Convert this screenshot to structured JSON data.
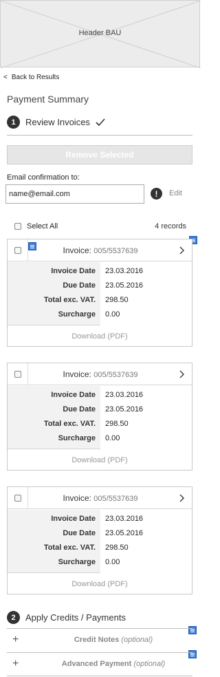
{
  "header": {
    "label": "Header BAU"
  },
  "nav": {
    "back_label": "Back to Results",
    "back_glyph": "<"
  },
  "page_title": "Payment Summary",
  "steps": [
    {
      "number": "1",
      "label": "Review Invoices",
      "done": true
    },
    {
      "number": "2",
      "label": "Apply Credits / Payments"
    }
  ],
  "actions": {
    "remove_selected": "Remove Selected"
  },
  "email": {
    "label": "Email confirmation to:",
    "value": "name@email.com",
    "alert_glyph": "!",
    "edit_label": "Edit"
  },
  "selection": {
    "select_all": "Select All",
    "records": "4 records"
  },
  "invoices": [
    {
      "title_label": "Invoice:",
      "number": "005/5537639",
      "invoice_date_label": "Invoice Date",
      "invoice_date": "23.03.2016",
      "due_date_label": "Due Date",
      "due_date": "23.05.2016",
      "total_label": "Total exc. VAT.",
      "total": "298.50",
      "surcharge_label": "Surcharge",
      "surcharge": "0.00",
      "download": "Download (PDF)"
    },
    {
      "title_label": "Invoice:",
      "number": "005/5537639",
      "invoice_date_label": "Invoice Date",
      "invoice_date": "23.03.2016",
      "due_date_label": "Due Date",
      "due_date": "23.05.2016",
      "total_label": "Total exc. VAT.",
      "total": "298.50",
      "surcharge_label": "Surcharge",
      "surcharge": "0.00",
      "download": "Download (PDF)"
    },
    {
      "title_label": "Invoice:",
      "number": "005/5537639",
      "invoice_date_label": "Invoice Date",
      "invoice_date": "23.03.2016",
      "due_date_label": "Due Date",
      "due_date": "23.05.2016",
      "total_label": "Total exc. VAT.",
      "total": "298.50",
      "surcharge_label": "Surcharge",
      "surcharge": "0.00",
      "download": "Download (PDF)"
    }
  ],
  "accordion": [
    {
      "label": "Credit Notes",
      "optional": "(optional)",
      "glyph": "+"
    },
    {
      "label": "Advanced Payment",
      "optional": "(optional)",
      "glyph": "+"
    }
  ],
  "colors": {
    "note_icon": "#3a7bd5",
    "step_badge": "#333333"
  }
}
